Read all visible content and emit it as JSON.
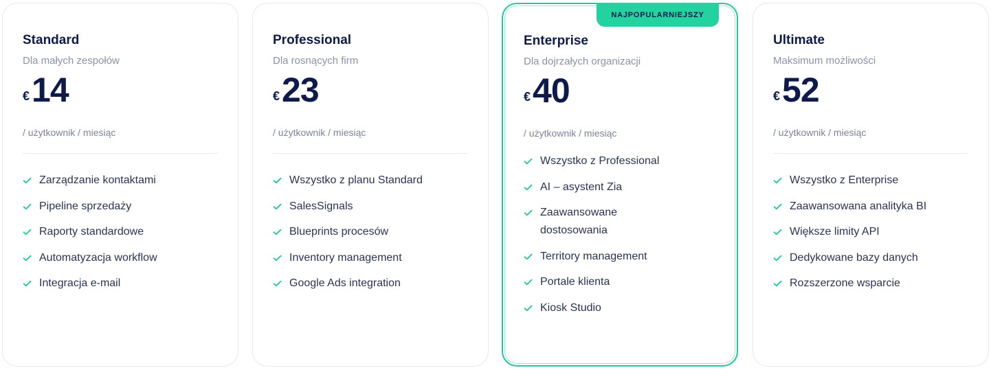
{
  "accent_color": "#20c997",
  "plans": [
    {
      "name": "Standard",
      "subtitle": "Dla małych zespołów",
      "currency": "€",
      "price": "14",
      "per": "/ użytkownik / miesiąc",
      "features": [
        "Zarządzanie kontaktami",
        "Pipeline sprzedaży",
        "Raporty standardowe",
        "Automatyzacja workflow",
        "Integracja e-mail"
      ]
    },
    {
      "name": "Professional",
      "subtitle": "Dla rosnących firm",
      "currency": "€",
      "price": "23",
      "per": "/ użytkownik / miesiąc",
      "features": [
        "Wszystko z planu Standard",
        "SalesSignals",
        "Blueprints procesów",
        "Inventory management",
        "Google Ads integration"
      ]
    },
    {
      "name": "Enterprise",
      "subtitle": "Dla dojrzałych organizacji",
      "currency": "€",
      "price": "40",
      "per": "/ użytkownik / miesiąc",
      "badge": "NAJPOPULARNIEJSZY",
      "features": [
        "Wszystko z Professional",
        "AI – asystent Zia",
        "Zaawansowane dostosowania",
        "Territory management",
        "Portale klienta",
        "Kiosk Studio"
      ]
    },
    {
      "name": "Ultimate",
      "subtitle": "Maksimum możliwości",
      "currency": "€",
      "price": "52",
      "per": "/ użytkownik / miesiąc",
      "features": [
        "Wszystko z Enterprise",
        "Zaawansowana analityka BI",
        "Większe limity API",
        "Dedykowane bazy danych",
        "Rozszerzone wsparcie"
      ]
    }
  ]
}
